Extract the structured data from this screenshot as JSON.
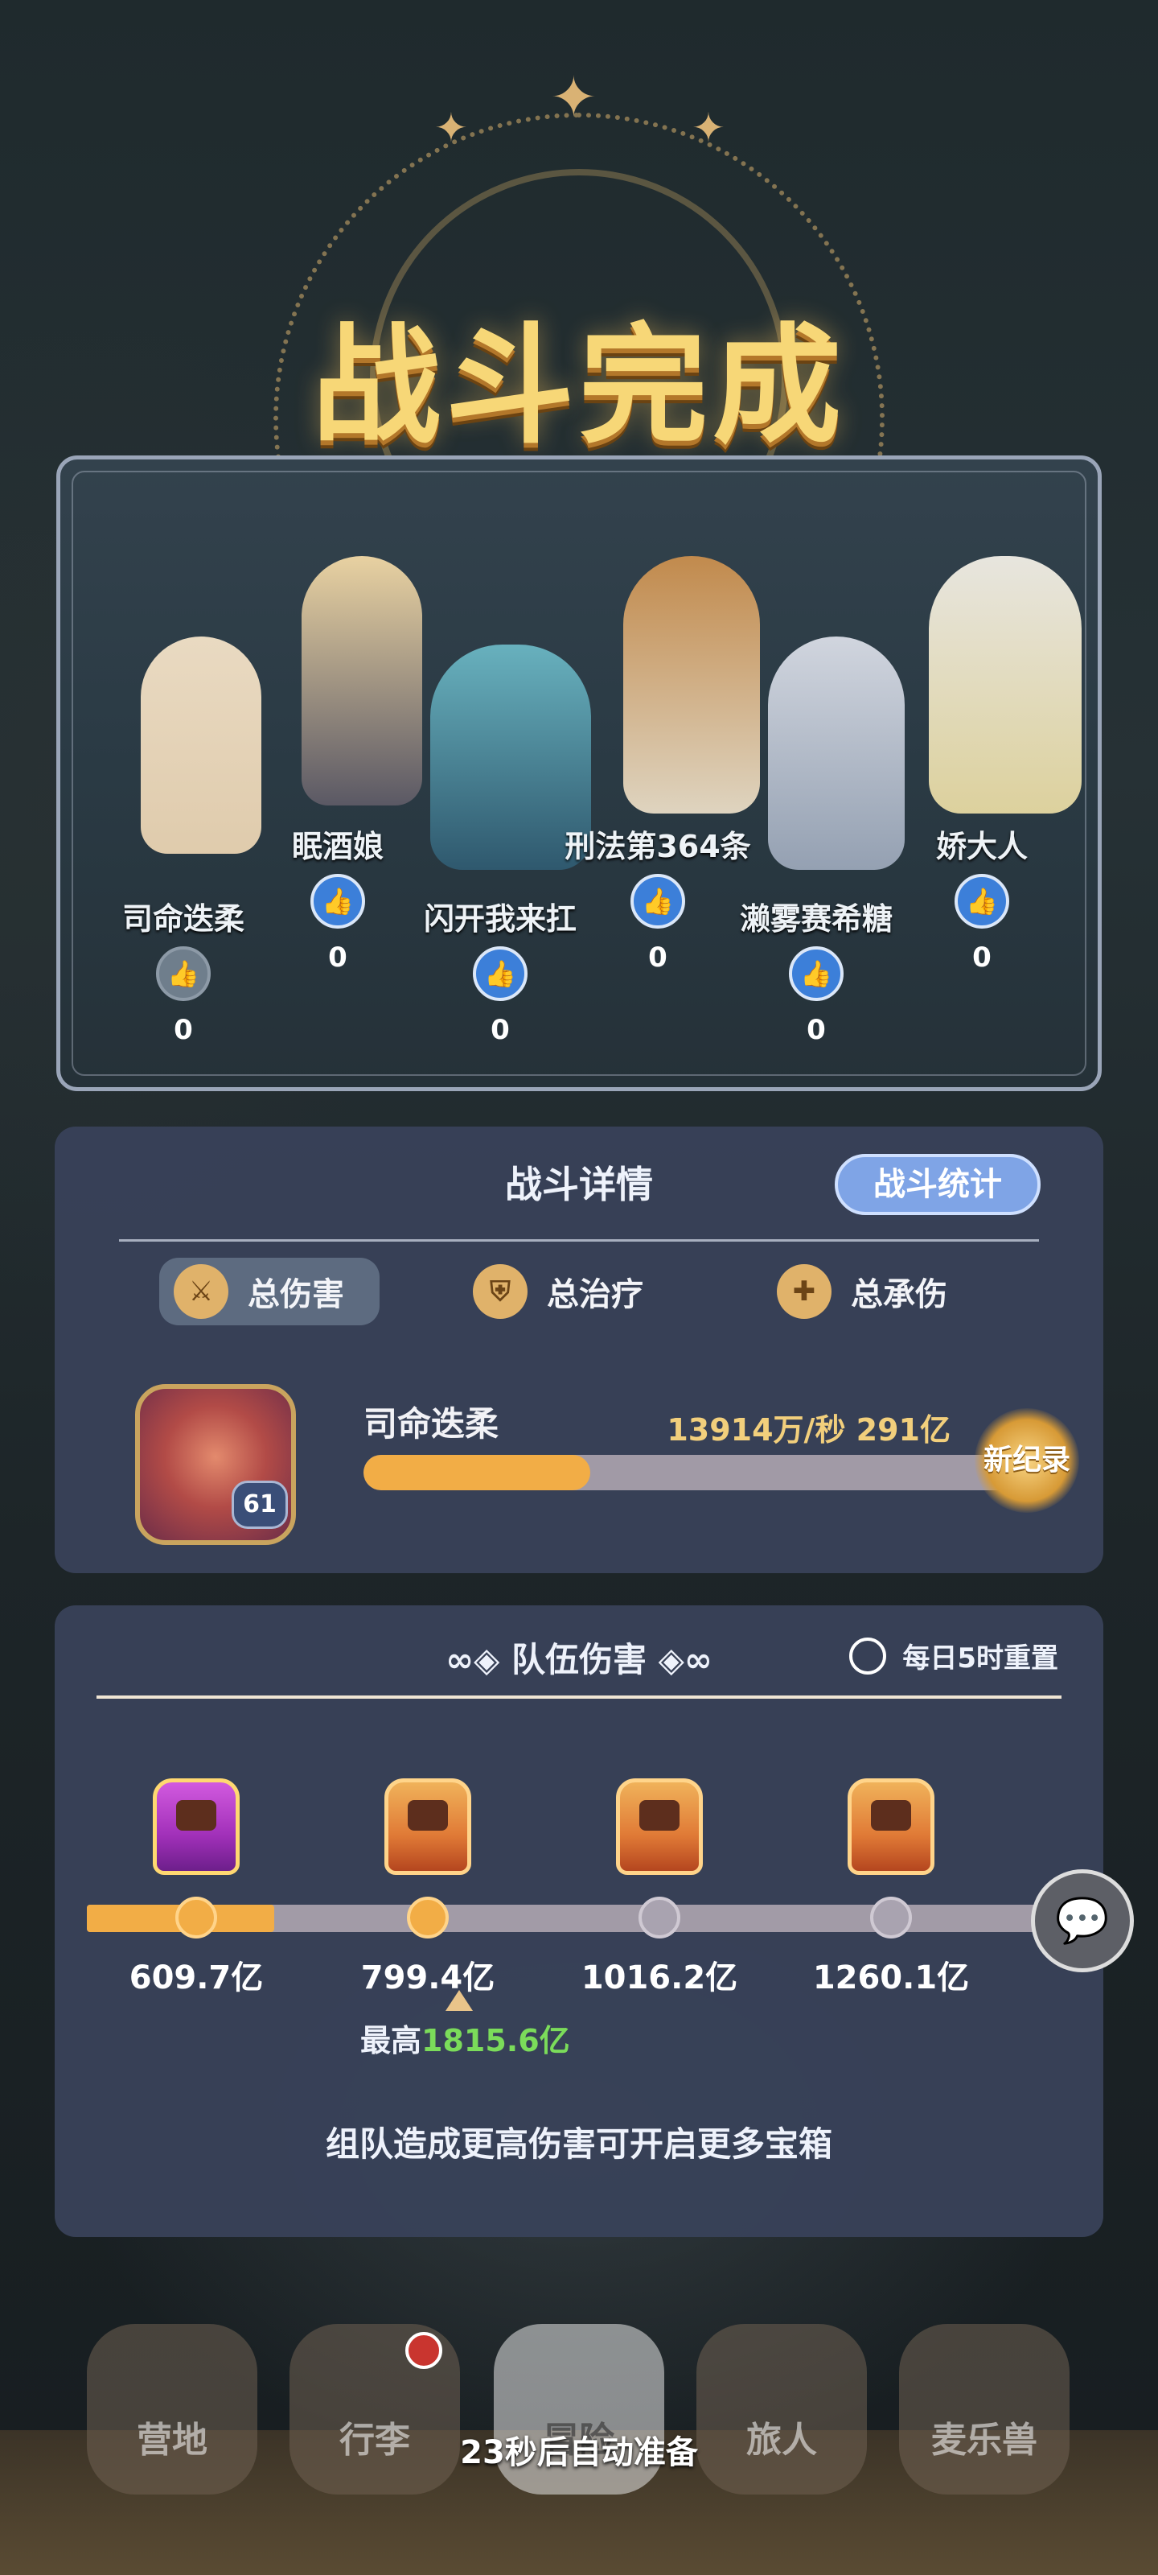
{
  "title": "战斗完成",
  "team": [
    {
      "name": "司命迭柔",
      "likes": "0",
      "like_active": false
    },
    {
      "name": "眠酒娘",
      "likes": "0",
      "like_active": true
    },
    {
      "name": "闪开我来扛",
      "likes": "0",
      "like_active": true
    },
    {
      "name": "刑法第364条",
      "likes": "0",
      "like_active": true
    },
    {
      "name": "濑雾赛希糖",
      "likes": "0",
      "like_active": true
    },
    {
      "name": "娇大人",
      "likes": "0",
      "like_active": true
    }
  ],
  "details": {
    "title": "战斗详情",
    "stats_button": "战斗统计",
    "tabs": [
      {
        "label": "总伤害",
        "icon": "sword-icon",
        "active": true
      },
      {
        "label": "总治疗",
        "icon": "shield-icon",
        "active": false
      },
      {
        "label": "总承伤",
        "icon": "plus-icon",
        "active": false
      }
    ],
    "hero": {
      "name": "司命迭柔",
      "level": "61",
      "stats": "13914万/秒  291亿",
      "progress": 0.34,
      "badge": "新纪录"
    }
  },
  "team_damage": {
    "title": "队伍伤害",
    "reset": "每日5时重置",
    "thresholds": [
      "609.7亿",
      "799.4亿",
      "1016.2亿",
      "1260.1亿"
    ],
    "reached": 2,
    "progress": 0.19,
    "max_label": "最高",
    "max_value": "1815.6亿",
    "hint": "组队造成更高伤害可开启更多宝箱"
  },
  "bottom_nav": [
    {
      "label": "营地"
    },
    {
      "label": "行李"
    },
    {
      "label": "冒险"
    },
    {
      "label": "旅人"
    },
    {
      "label": "麦乐兽"
    }
  ],
  "auto_ready": "23秒后自动准备",
  "colors": {
    "accent": "#f2ad46",
    "like": "#3c7fd9",
    "record": "#7bdc5a"
  }
}
